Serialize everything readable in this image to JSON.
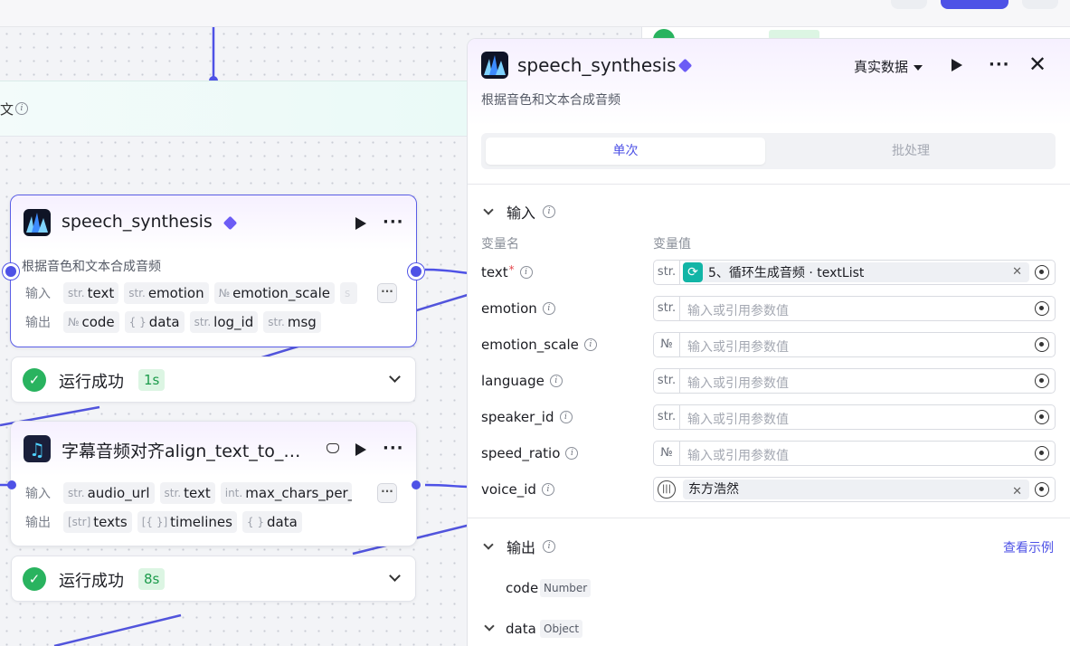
{
  "canvas": {
    "band_label": "文"
  },
  "node1": {
    "title": "speech_synthesis",
    "desc": "根据音色和文本合成音频",
    "in_label": "输入",
    "out_label": "输出",
    "inputs": [
      {
        "type": "str.",
        "name": "text"
      },
      {
        "type": "str.",
        "name": "emotion"
      },
      {
        "type": "№",
        "name": "emotion_scale"
      },
      {
        "type": "s",
        "name": ""
      }
    ],
    "outputs": [
      {
        "type": "№",
        "name": "code"
      },
      {
        "type": "{ }",
        "name": "data"
      },
      {
        "type": "str.",
        "name": "log_id"
      },
      {
        "type": "str.",
        "name": "msg"
      }
    ],
    "more_label": "···"
  },
  "status1": {
    "text": "运行成功",
    "time": "1s"
  },
  "node2": {
    "title": "字幕音频对齐align_text_to_…",
    "in_label": "输入",
    "out_label": "输出",
    "inputs": [
      {
        "type": "str.",
        "name": "audio_url"
      },
      {
        "type": "str.",
        "name": "text"
      },
      {
        "type": "int.",
        "name": "max_chars_per_l"
      }
    ],
    "outputs": [
      {
        "type": "[str]",
        "name": "texts"
      },
      {
        "type": "[{ }]",
        "name": "timelines"
      },
      {
        "type": "{ }",
        "name": "data"
      }
    ],
    "more_label": "···"
  },
  "status2": {
    "text": "运行成功",
    "time": "8s"
  },
  "panel": {
    "title": "speech_synthesis",
    "desc": "根据音色和文本合成音频",
    "dropdown": "真实数据",
    "tabs": [
      "单次",
      "批处理"
    ],
    "input_section": "输入",
    "col_name": "变量名",
    "col_value": "变量值",
    "placeholder": "输入或引用参数值",
    "params": [
      {
        "name": "text",
        "required": true,
        "type": "str.",
        "ref": "5、循环生成音频 · textList"
      },
      {
        "name": "emotion",
        "required": false,
        "type": "str."
      },
      {
        "name": "emotion_scale",
        "required": false,
        "type": "№"
      },
      {
        "name": "language",
        "required": false,
        "type": "str."
      },
      {
        "name": "speaker_id",
        "required": false,
        "type": "str."
      },
      {
        "name": "speed_ratio",
        "required": false,
        "type": "№"
      },
      {
        "name": "voice_id",
        "required": false,
        "type": "voice",
        "ref": "东方浩然"
      }
    ],
    "output_section": "输出",
    "view_example": "查看示例",
    "outputs": [
      {
        "name": "code",
        "type": "Number"
      },
      {
        "name": "data",
        "type": "Object"
      }
    ]
  },
  "colors": {
    "accent": "#4e52e6",
    "success": "#29b35f",
    "loop": "#12b5a6",
    "diamond": "#6c5cf5"
  }
}
